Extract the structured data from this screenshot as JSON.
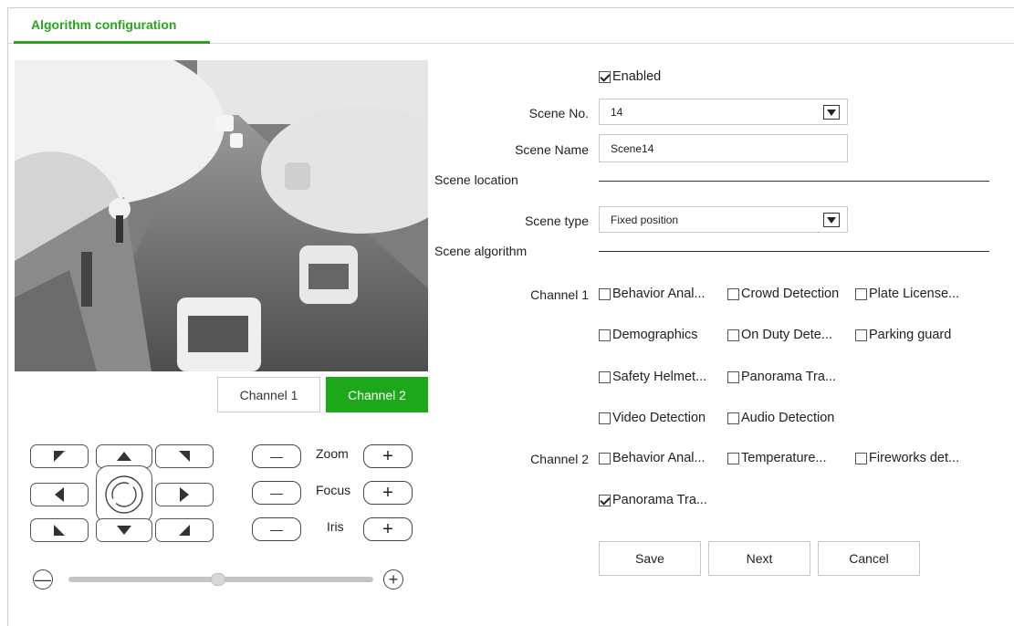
{
  "tabs": {
    "active": "Algorithm configuration"
  },
  "preview": {
    "channel_buttons": [
      "Channel 1",
      "Channel 2"
    ],
    "selected_channel": "Channel 2"
  },
  "ptz": {
    "zoom_label": "Zoom",
    "focus_label": "Focus",
    "iris_label": "Iris",
    "minus": "—",
    "plus": "+",
    "speed_level": 0.47
  },
  "form": {
    "enabled_label": "Enabled",
    "scene_no_label": "Scene No.",
    "scene_no_value": "14",
    "scene_name_label": "Scene Name",
    "scene_name_value": "Scene14",
    "scene_location_label": "Scene location",
    "scene_type_label": "Scene type",
    "scene_type_value": "Fixed position",
    "scene_algorithm_label": "Scene algorithm",
    "channel1_label": "Channel 1",
    "channel2_label": "Channel 2",
    "channel1_algorithms": [
      "Behavior Anal...",
      "Crowd Detection",
      "Plate License...",
      "Demographics",
      "On Duty Dete...",
      "Parking guard",
      "Safety Helmet...",
      "Panorama Tra...",
      "Video Detection",
      "Audio Detection"
    ],
    "channel2_algorithms": [
      "Behavior Anal...",
      "Temperature...",
      "Fireworks det...",
      "Panorama Tra..."
    ]
  },
  "actions": {
    "save": "Save",
    "next": "Next",
    "cancel": "Cancel"
  },
  "colors": {
    "accent": "#1da81a",
    "tab_text": "#28a51e"
  }
}
